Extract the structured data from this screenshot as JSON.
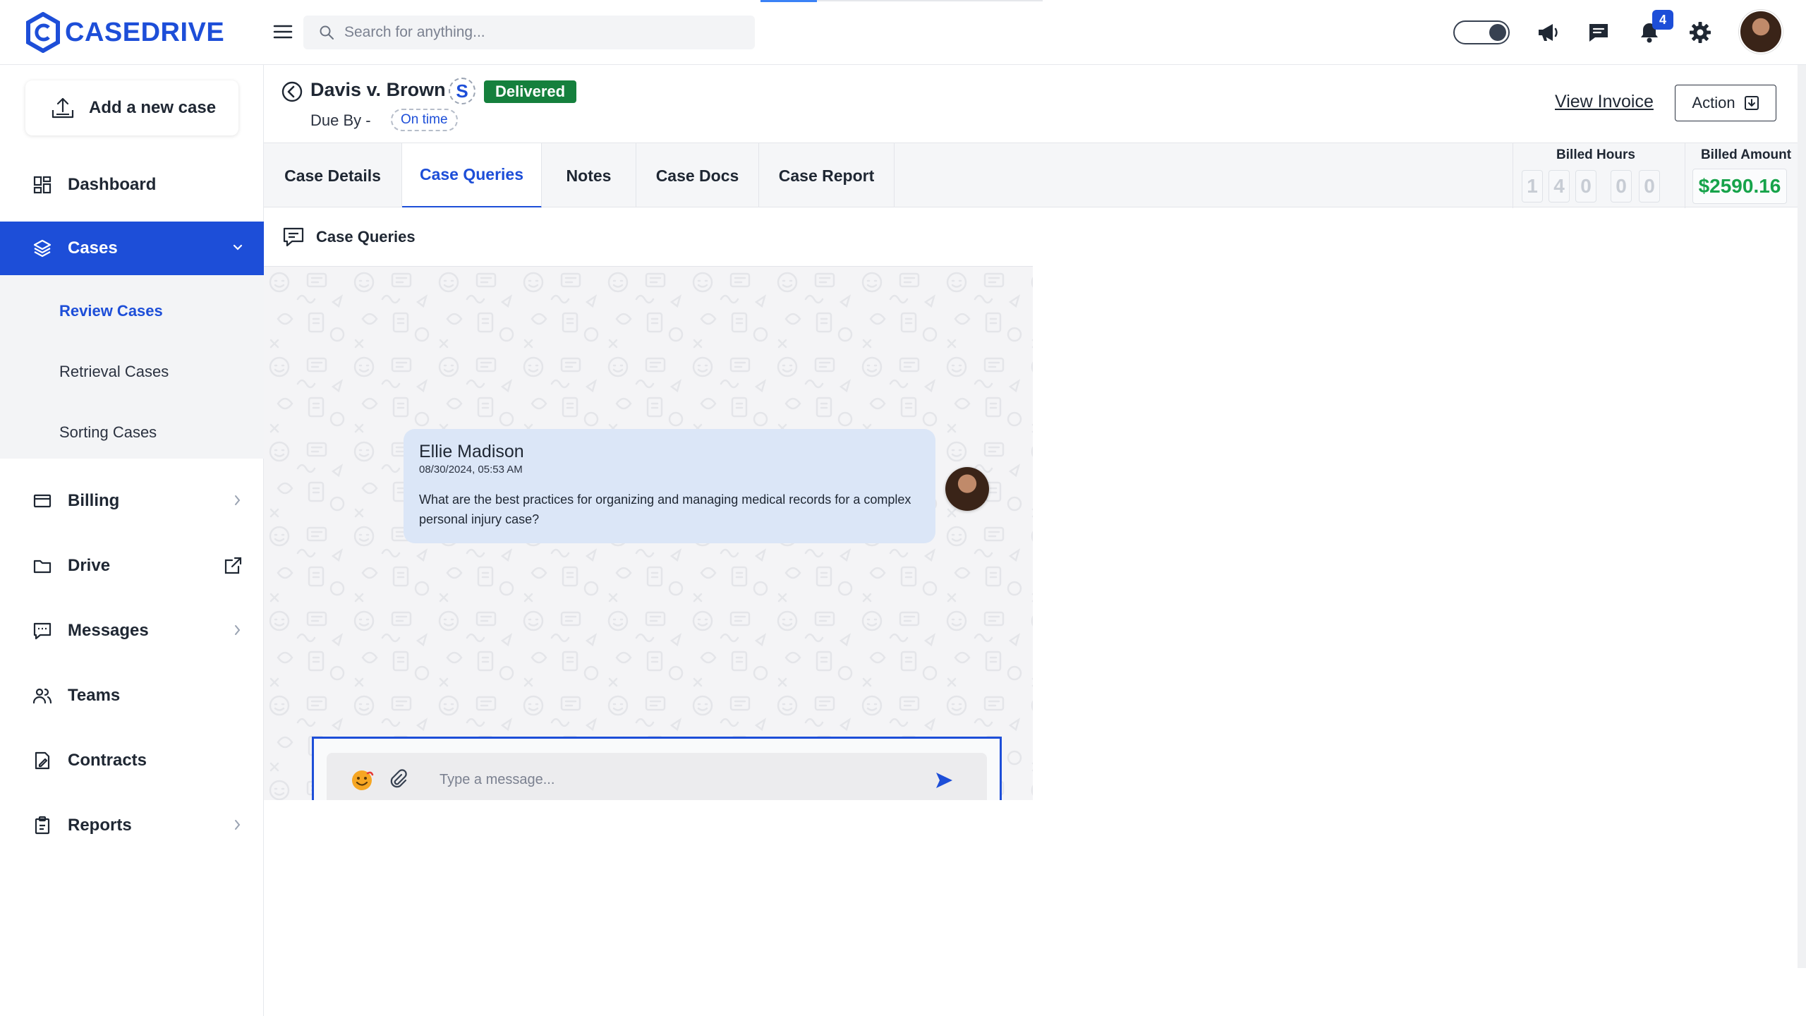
{
  "brand": {
    "name": "CASEDRIVE",
    "color": "#1d4ed8"
  },
  "header": {
    "search_placeholder": "Search for anything...",
    "notification_count": "4",
    "icons": [
      "menu-icon",
      "search-icon",
      "theme-toggle",
      "megaphone-icon",
      "chat-icon",
      "bell-icon",
      "gear-icon",
      "avatar"
    ]
  },
  "sidebar": {
    "add_case_label": "Add a new case",
    "items": [
      {
        "label": "Dashboard",
        "icon": "dashboard-icon"
      },
      {
        "label": "Cases",
        "icon": "layers-icon",
        "active": true
      },
      {
        "label": "Billing",
        "icon": "card-icon"
      },
      {
        "label": "Drive",
        "icon": "folder-icon"
      },
      {
        "label": "Messages",
        "icon": "message-icon"
      },
      {
        "label": "Teams",
        "icon": "users-icon"
      },
      {
        "label": "Contracts",
        "icon": "contract-icon"
      },
      {
        "label": "Reports",
        "icon": "report-icon"
      }
    ],
    "cases_submenu": [
      {
        "label": "Review Cases",
        "active": true
      },
      {
        "label": "Retrieval Cases"
      },
      {
        "label": "Sorting Cases"
      }
    ]
  },
  "case": {
    "title": "Davis v. Brown",
    "s_badge": "S",
    "status": "Delivered",
    "due_label": "Due By -",
    "due_status": "On time",
    "view_invoice": "View Invoice",
    "action_label": "Action"
  },
  "tabs": [
    {
      "label": "Case Details"
    },
    {
      "label": "Case Queries",
      "active": true
    },
    {
      "label": "Notes"
    },
    {
      "label": "Case Docs"
    },
    {
      "label": "Case Report"
    }
  ],
  "billing": {
    "hours_label": "Billed Hours",
    "hours_digits": [
      "1",
      "4",
      "0",
      "0",
      "0"
    ],
    "amount_label": "Billed Amount",
    "amount_value": "$2590.16"
  },
  "queries": {
    "panel_title": "Case Queries",
    "messages": [
      {
        "author": "Ellie Madison",
        "timestamp": "08/30/2024, 05:53 AM",
        "text": "What are the best practices for organizing and managing medical records for a complex personal injury case?"
      }
    ],
    "composer_placeholder": "Type a message..."
  }
}
